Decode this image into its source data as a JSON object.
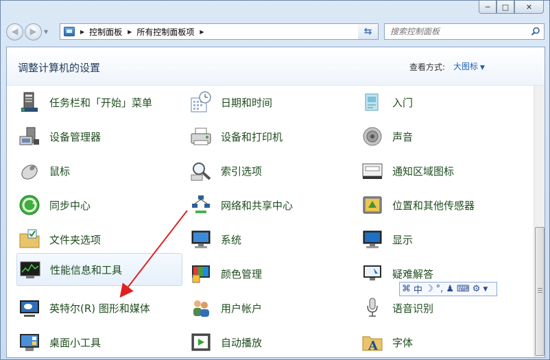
{
  "window": {
    "controls": {
      "minimize": "─",
      "maximize": "□",
      "close": "✕"
    }
  },
  "address_bar": {
    "crumbs": [
      "控制面板",
      "所有控制面板项"
    ]
  },
  "search": {
    "placeholder": "搜索控制面板"
  },
  "header": {
    "title": "调整计算机的设置",
    "view_label": "查看方式:",
    "view_value": "大图标"
  },
  "items": [
    {
      "label": "任务栏和「开始」菜单",
      "icon": "taskbar-icon"
    },
    {
      "label": "日期和时间",
      "icon": "clock-calendar-icon"
    },
    {
      "label": "入门",
      "icon": "getting-started-icon"
    },
    {
      "label": "设备管理器",
      "icon": "device-manager-icon"
    },
    {
      "label": "设备和打印机",
      "icon": "printer-icon"
    },
    {
      "label": "声音",
      "icon": "speaker-icon"
    },
    {
      "label": "鼠标",
      "icon": "mouse-icon"
    },
    {
      "label": "索引选项",
      "icon": "magnifier-icon"
    },
    {
      "label": "通知区域图标",
      "icon": "notification-icon"
    },
    {
      "label": "同步中心",
      "icon": "sync-icon"
    },
    {
      "label": "网络和共享中心",
      "icon": "network-icon"
    },
    {
      "label": "位置和其他传感器",
      "icon": "sensor-icon"
    },
    {
      "label": "文件夹选项",
      "icon": "folder-icon"
    },
    {
      "label": "系统",
      "icon": "computer-icon"
    },
    {
      "label": "显示",
      "icon": "display-icon"
    },
    {
      "label": "性能信息和工具",
      "icon": "performance-icon"
    },
    {
      "label": "颜色管理",
      "icon": "color-icon"
    },
    {
      "label": "疑难解答",
      "icon": "troubleshoot-icon"
    },
    {
      "label": "英特尔(R) 图形和媒体",
      "icon": "intel-graphics-icon"
    },
    {
      "label": "用户帐户",
      "icon": "users-icon"
    },
    {
      "label": "语音识别",
      "icon": "microphone-icon"
    },
    {
      "label": "桌面小工具",
      "icon": "gadgets-icon"
    },
    {
      "label": "自动播放",
      "icon": "autoplay-icon"
    },
    {
      "label": "字体",
      "icon": "font-icon"
    }
  ],
  "ime_toolbar": {
    "mode": "中"
  },
  "colors": {
    "link_green": "#1f4d1f",
    "view_blue": "#1e5fb4",
    "title_blue": "#1e395b",
    "annotation_red": "#e02020"
  }
}
